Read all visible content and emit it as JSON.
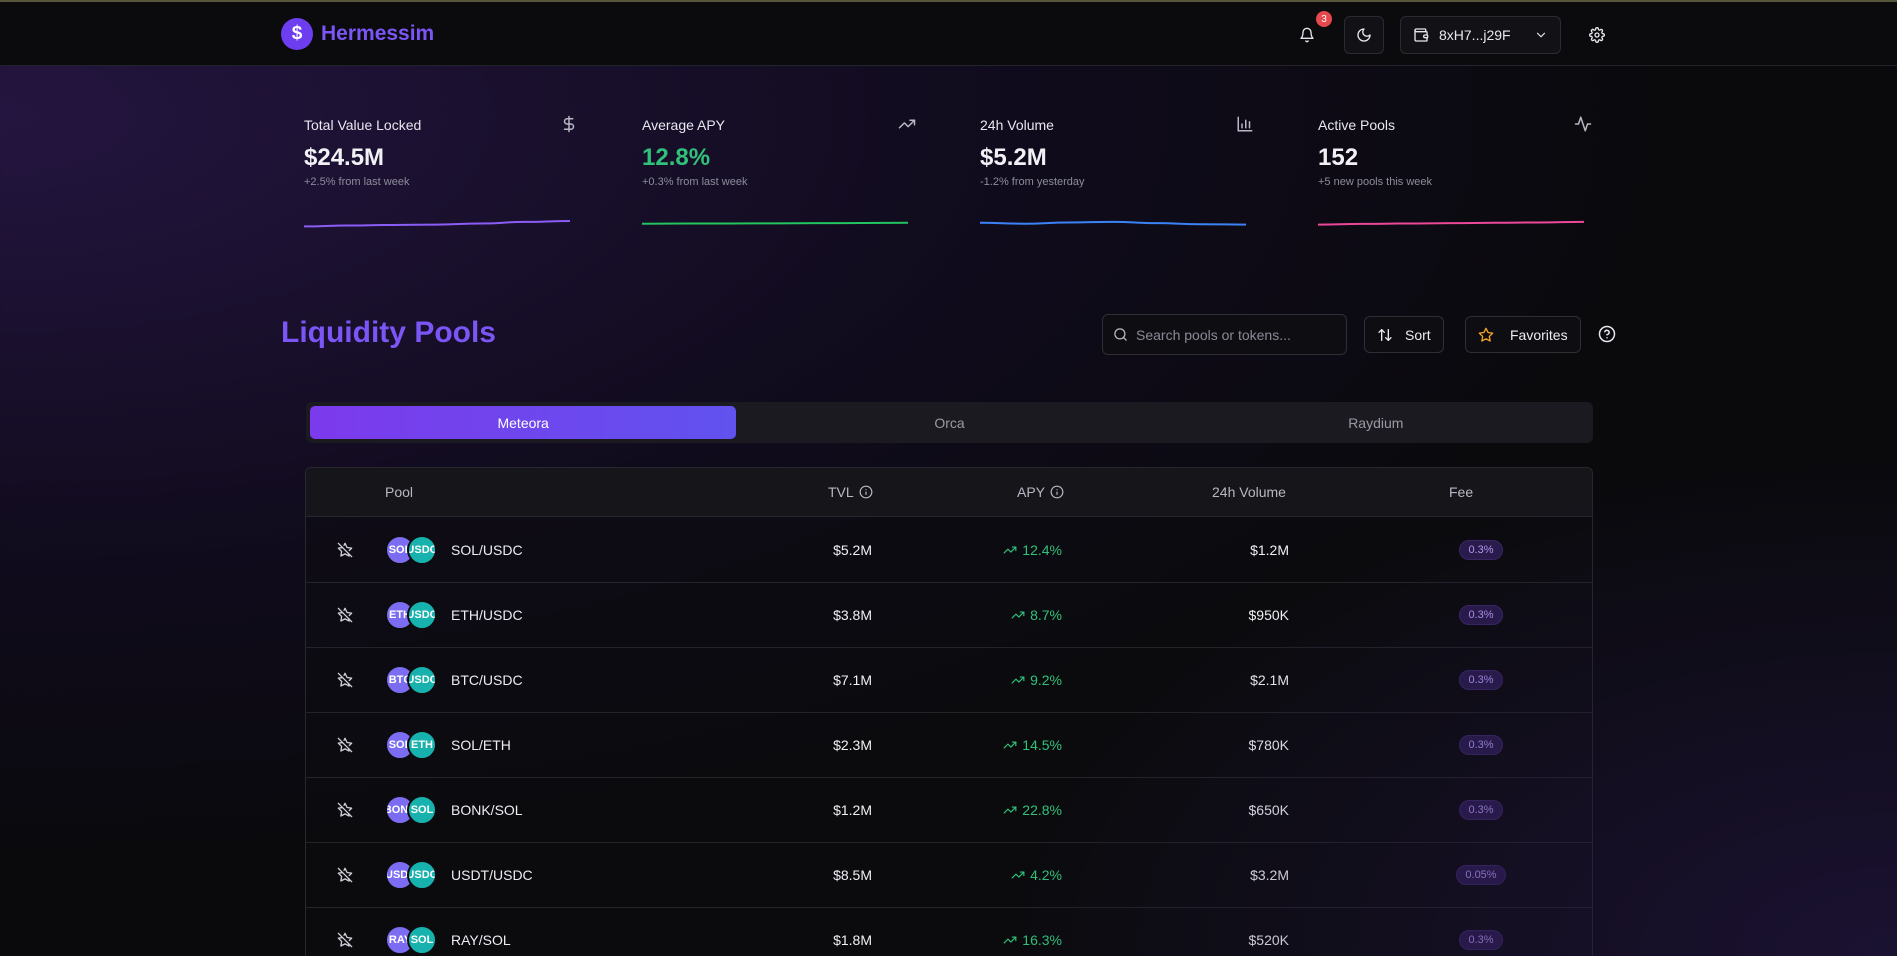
{
  "brand": {
    "name": "Hermessim",
    "logo_glyph": "$"
  },
  "header": {
    "notifications_count": "3",
    "wallet_address": "8xH7...j29F"
  },
  "stats": [
    {
      "label": "Total Value Locked",
      "value": "$24.5M",
      "sub": "+2.5% from last week",
      "icon": "dollar-icon",
      "color": "#8b5cf6",
      "trend": [
        0.2,
        0.25,
        0.28,
        0.3,
        0.36,
        0.45,
        0.5
      ]
    },
    {
      "label": "Average APY",
      "value": "12.8%",
      "sub": "+0.3% from last week",
      "icon": "trending-up-icon",
      "color": "#22c55e",
      "trend": [
        0.35,
        0.36,
        0.36,
        0.37,
        0.38,
        0.39,
        0.4
      ]
    },
    {
      "label": "24h Volume",
      "value": "$5.2M",
      "sub": "-1.2% from yesterday",
      "icon": "bar-chart-icon",
      "color": "#3b82f6",
      "trend": [
        0.4,
        0.35,
        0.42,
        0.45,
        0.38,
        0.32,
        0.3
      ]
    },
    {
      "label": "Active Pools",
      "value": "152",
      "sub": "+5 new pools this week",
      "icon": "activity-icon",
      "color": "#ec4899",
      "trend": [
        0.3,
        0.34,
        0.36,
        0.38,
        0.4,
        0.42,
        0.45
      ]
    }
  ],
  "pools": {
    "title": "Liquidity Pools",
    "search_placeholder": "Search pools or tokens...",
    "sort_label": "Sort",
    "favorites_label": "Favorites",
    "tabs": [
      "Meteora",
      "Orca",
      "Raydium"
    ],
    "active_tab": 0,
    "columns": {
      "pool": "Pool",
      "tvl": "TVL",
      "apy": "APY",
      "volume": "24h Volume",
      "fee": "Fee"
    },
    "rows": [
      {
        "a": "SOL",
        "b": "USDC",
        "pair": "SOL/USDC",
        "tvl": "$5.2M",
        "apy": "12.4%",
        "volume": "$1.2M",
        "fee": "0.3%"
      },
      {
        "a": "ETH",
        "b": "USDC",
        "pair": "ETH/USDC",
        "tvl": "$3.8M",
        "apy": "8.7%",
        "volume": "$950K",
        "fee": "0.3%"
      },
      {
        "a": "BTC",
        "b": "USDC",
        "pair": "BTC/USDC",
        "tvl": "$7.1M",
        "apy": "9.2%",
        "volume": "$2.1M",
        "fee": "0.3%"
      },
      {
        "a": "SOL",
        "b": "ETH",
        "pair": "SOL/ETH",
        "tvl": "$2.3M",
        "apy": "14.5%",
        "volume": "$780K",
        "fee": "0.3%"
      },
      {
        "a": "BONK",
        "b": "SOL",
        "pair": "BONK/SOL",
        "tvl": "$1.2M",
        "apy": "22.8%",
        "volume": "$650K",
        "fee": "0.3%"
      },
      {
        "a": "USDT",
        "b": "USDC",
        "pair": "USDT/USDC",
        "tvl": "$8.5M",
        "apy": "4.2%",
        "volume": "$3.2M",
        "fee": "0.05%"
      },
      {
        "a": "RAY",
        "b": "SOL",
        "pair": "RAY/SOL",
        "tvl": "$1.8M",
        "apy": "16.3%",
        "volume": "$520K",
        "fee": "0.3%"
      }
    ]
  }
}
